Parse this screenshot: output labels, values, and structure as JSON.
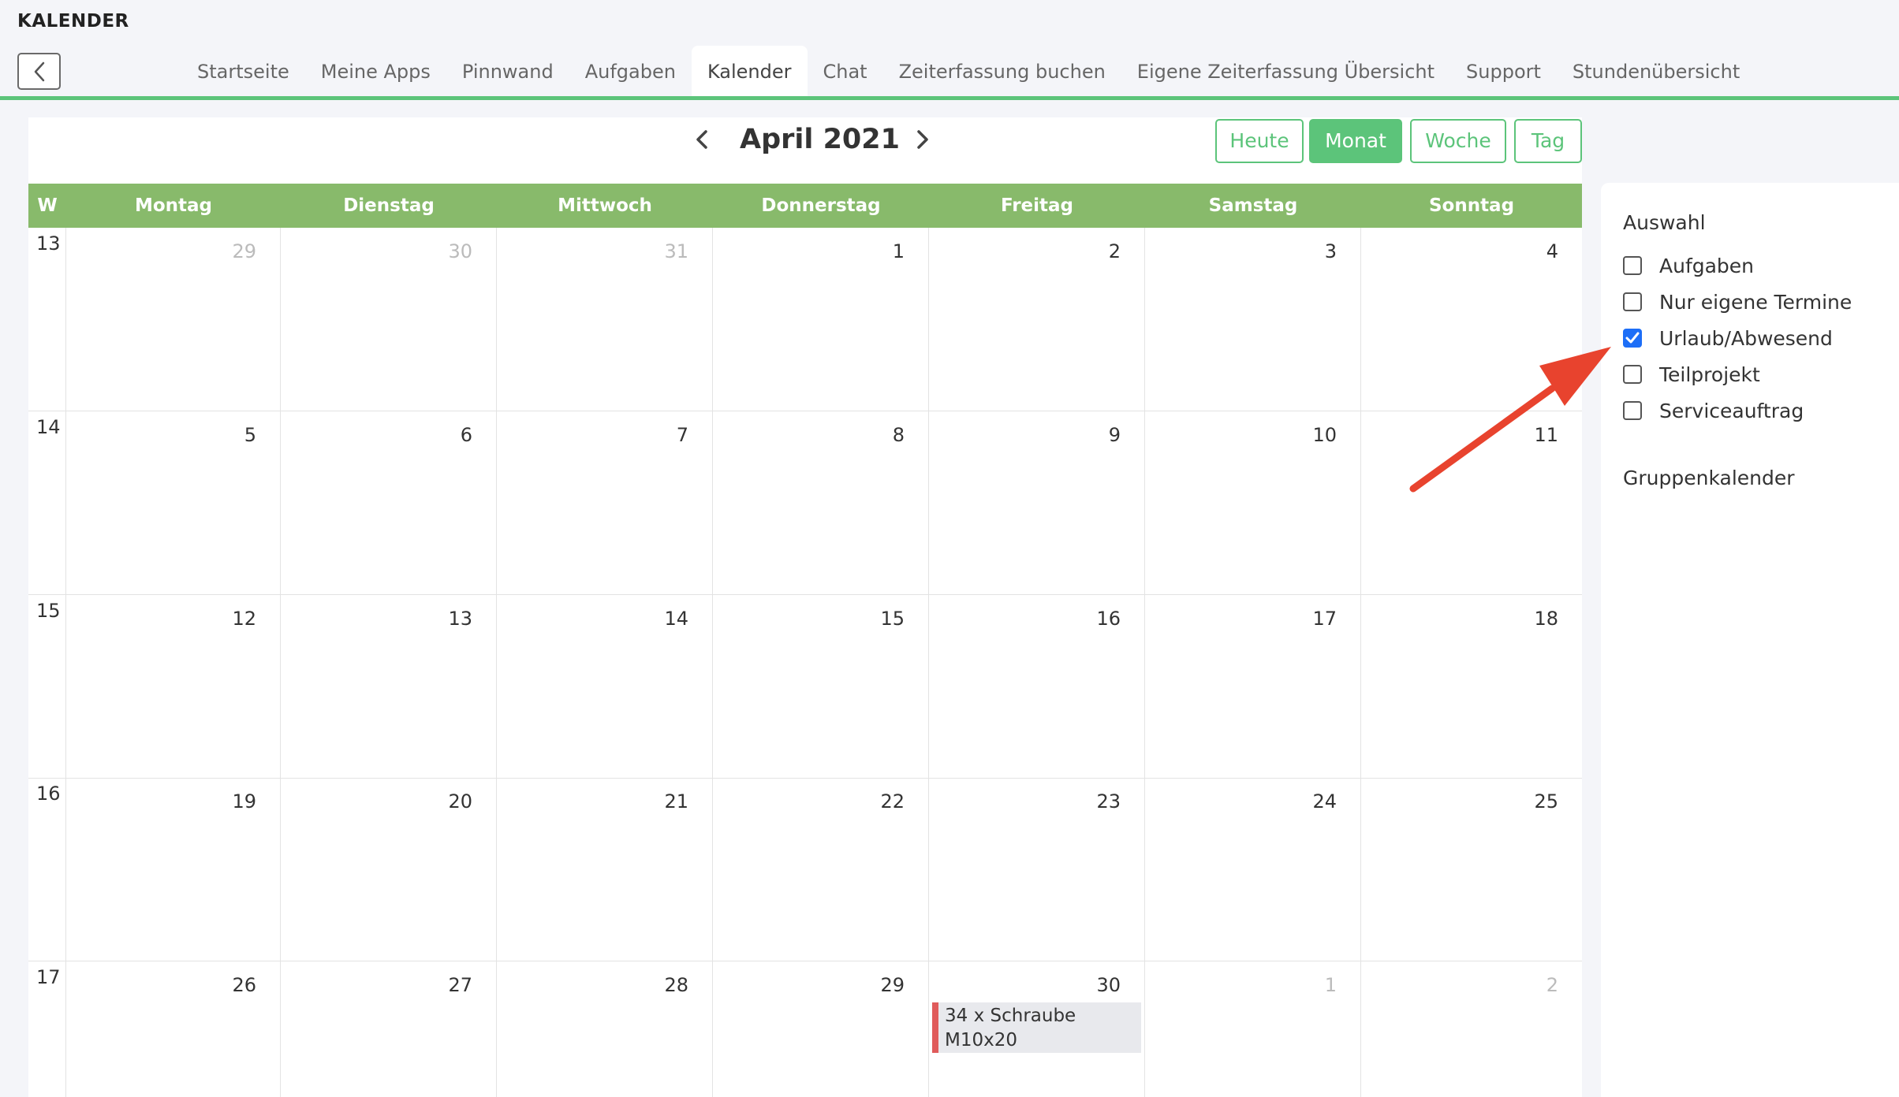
{
  "app": {
    "title": "KALENDER"
  },
  "nav": {
    "tabs": [
      {
        "label": "Startseite"
      },
      {
        "label": "Meine Apps"
      },
      {
        "label": "Pinnwand"
      },
      {
        "label": "Aufgaben"
      },
      {
        "label": "Kalender",
        "active": true
      },
      {
        "label": "Chat"
      },
      {
        "label": "Zeiterfassung buchen"
      },
      {
        "label": "Eigene Zeiterfassung Übersicht"
      },
      {
        "label": "Support"
      },
      {
        "label": "Stundenübersicht"
      }
    ]
  },
  "calendar": {
    "title": "April 2021",
    "views": {
      "today": "Heute",
      "month": "Monat",
      "week": "Woche",
      "day": "Tag"
    },
    "active_view": "Monat",
    "head": {
      "week_col": "W",
      "days": [
        "Montag",
        "Dienstag",
        "Mittwoch",
        "Donnerstag",
        "Freitag",
        "Samstag",
        "Sonntag"
      ]
    },
    "weeks": [
      {
        "wk": "13",
        "days": [
          {
            "n": "29",
            "other": true
          },
          {
            "n": "30",
            "other": true
          },
          {
            "n": "31",
            "other": true
          },
          {
            "n": "1"
          },
          {
            "n": "2"
          },
          {
            "n": "3"
          },
          {
            "n": "4"
          }
        ]
      },
      {
        "wk": "14",
        "days": [
          {
            "n": "5"
          },
          {
            "n": "6"
          },
          {
            "n": "7"
          },
          {
            "n": "8"
          },
          {
            "n": "9"
          },
          {
            "n": "10"
          },
          {
            "n": "11"
          }
        ]
      },
      {
        "wk": "15",
        "days": [
          {
            "n": "12"
          },
          {
            "n": "13"
          },
          {
            "n": "14"
          },
          {
            "n": "15"
          },
          {
            "n": "16"
          },
          {
            "n": "17"
          },
          {
            "n": "18"
          }
        ]
      },
      {
        "wk": "16",
        "days": [
          {
            "n": "19"
          },
          {
            "n": "20"
          },
          {
            "n": "21"
          },
          {
            "n": "22"
          },
          {
            "n": "23"
          },
          {
            "n": "24"
          },
          {
            "n": "25"
          }
        ]
      },
      {
        "wk": "17",
        "days": [
          {
            "n": "26"
          },
          {
            "n": "27"
          },
          {
            "n": "28"
          },
          {
            "n": "29"
          },
          {
            "n": "30",
            "event": " 34 x Schraube M10x20"
          },
          {
            "n": "1",
            "other": true
          },
          {
            "n": "2",
            "other": true
          }
        ]
      }
    ]
  },
  "sidebar": {
    "selection_title": "Auswahl",
    "options": [
      {
        "label": "Aufgaben",
        "checked": false
      },
      {
        "label": "Nur eigene Termine",
        "checked": false
      },
      {
        "label": "Urlaub/Abwesend",
        "checked": true
      },
      {
        "label": "Teilprojekt",
        "checked": false
      },
      {
        "label": "Serviceauftrag",
        "checked": false
      }
    ],
    "group_title": "Gruppenkalender"
  },
  "colors": {
    "accent_green": "#5cc47a",
    "header_green": "#88ba6b",
    "checkbox_blue": "#1d6ef7",
    "event_bar": "#e05b5b",
    "annotation_red": "#e8432e"
  }
}
